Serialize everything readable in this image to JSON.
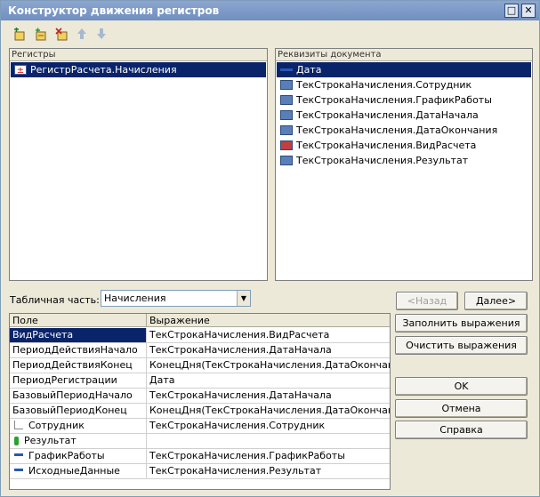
{
  "window": {
    "title": "Конструктор движения регистров"
  },
  "titlebar": {
    "maximize_glyph": "□",
    "close_glyph": "✕"
  },
  "toolbar": {
    "icons": [
      "add-register-icon",
      "add-line-icon",
      "delete-icon",
      "move-up-icon",
      "move-down-icon"
    ]
  },
  "registers": {
    "header": "Регистры",
    "items": [
      {
        "label": "РегистрРасчета.Начисления",
        "selected": true
      }
    ]
  },
  "attributes": {
    "header": "Реквизиты документа",
    "items": [
      {
        "label": "Дата",
        "selected": true
      },
      {
        "label": "ТекСтрокаНачисления.Сотрудник"
      },
      {
        "label": "ТекСтрокаНачисления.ГрафикРаботы"
      },
      {
        "label": "ТекСтрокаНачисления.ДатаНачала"
      },
      {
        "label": "ТекСтрокаНачисления.ДатаОкончания"
      },
      {
        "label": "ТекСтрокаНачисления.ВидРасчета"
      },
      {
        "label": "ТекСтрокаНачисления.Результат"
      }
    ]
  },
  "tabular": {
    "label": "Табличная часть:",
    "value": "Начисления"
  },
  "nav": {
    "back": "<Назад",
    "next": "Далее>"
  },
  "grid": {
    "columns": [
      "Поле",
      "Выражение"
    ],
    "rows": [
      {
        "field": "ВидРасчета",
        "expr": "ТекСтрокаНачисления.ВидРасчета"
      },
      {
        "field": "ПериодДействияНачало",
        "expr": "ТекСтрокаНачисления.ДатаНачала"
      },
      {
        "field": "ПериодДействияКонец",
        "expr": "КонецДня(ТекСтрокаНачисления.ДатаОкончания)"
      },
      {
        "field": "ПериодРегистрации",
        "expr": "Дата"
      },
      {
        "field": "БазовыйПериодНачало",
        "expr": "ТекСтрокаНачисления.ДатаНачала"
      },
      {
        "field": "БазовыйПериодКонец",
        "expr": "КонецДня(ТекСтрокаНачисления.ДатаОкончания)"
      },
      {
        "field": "Сотрудник",
        "expr": "ТекСтрокаНачисления.Сотрудник"
      },
      {
        "field": "Результат",
        "expr": ""
      },
      {
        "field": "ГрафикРаботы",
        "expr": "ТекСтрокаНачисления.ГрафикРаботы"
      },
      {
        "field": "ИсходныеДанные",
        "expr": "ТекСтрокаНачисления.Результат"
      }
    ]
  },
  "actions": {
    "fill": "Заполнить выражения",
    "clear": "Очистить выражения",
    "ok": "OK",
    "cancel": "Отмена",
    "help": "Справка"
  }
}
